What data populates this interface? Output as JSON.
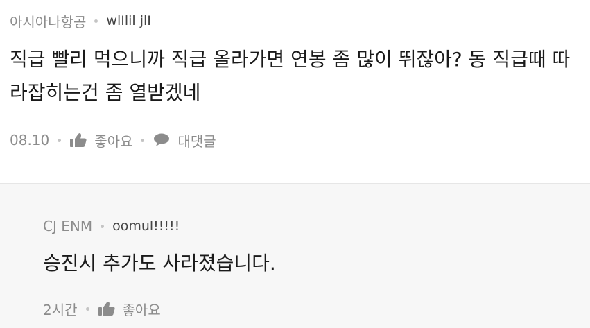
{
  "comment": {
    "company": "아시아나항공",
    "nickname": "wlIlil jlI",
    "text": "직급 빨리 먹으니까 직급 올라가면 연봉 좀 많이 뛰잖아? 동 직급때 따라잡히는건 좀 열받겠네",
    "date": "08.10",
    "like_label": "좋아요",
    "reply_label": "대댓글"
  },
  "reply": {
    "company": "CJ ENM",
    "nickname": "oomul!!!!!",
    "text": "승진시 추가도 사라졌습니다.",
    "time": "2시간",
    "like_label": "좋아요"
  },
  "icons": {
    "like": "thumbs-up-icon",
    "reply": "speech-bubble-icon"
  },
  "colors": {
    "meta_text": "#8c8c8c",
    "body_text": "#1a1a1a",
    "reply_background": "#f7f7f7",
    "divider": "#e6e6e6"
  }
}
